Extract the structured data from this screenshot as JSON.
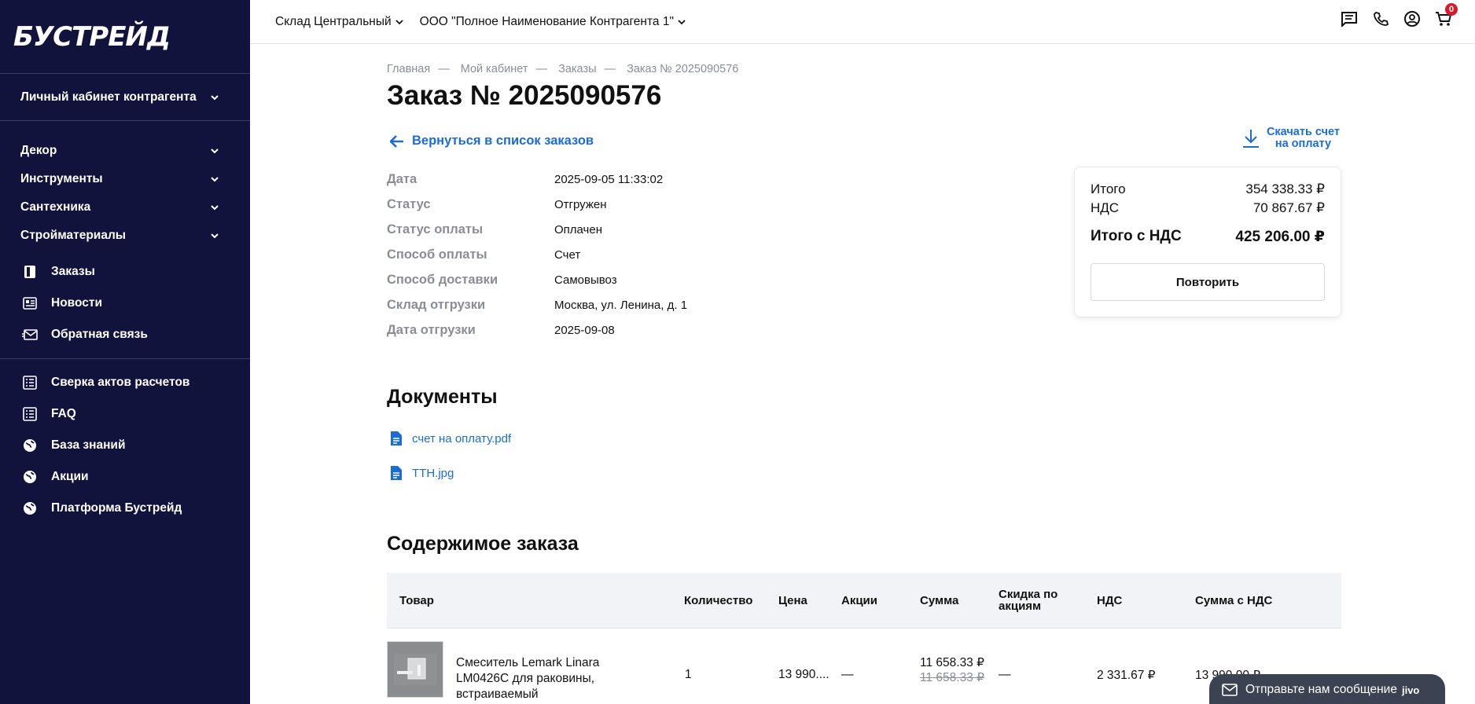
{
  "sidebar": {
    "logo": "БУСТРЕЙД",
    "cabinet": "Личный кабинет контрагента",
    "categories": [
      "Декор",
      "Инструменты",
      "Сантехника",
      "Стройматериалы"
    ],
    "links": [
      {
        "label": "Заказы",
        "icon": "orders-icon"
      },
      {
        "label": "Новости",
        "icon": "news-icon"
      },
      {
        "label": "Обратная связь",
        "icon": "mail-icon"
      }
    ],
    "links2": [
      {
        "label": "Сверка актов расчетов",
        "icon": "list-icon"
      },
      {
        "label": "FAQ",
        "icon": "list-icon"
      },
      {
        "label": "База знаний",
        "icon": "globe-icon"
      },
      {
        "label": "Акции",
        "icon": "globe-icon"
      },
      {
        "label": "Платформа Бустрейд",
        "icon": "globe-icon"
      }
    ]
  },
  "topbar": {
    "warehouse": "Склад Центральный",
    "counterparty": "ООО \"Полное Наименование Контрагента 1\"",
    "cart_count": "0"
  },
  "breadcrumb": [
    "Главная",
    "Мой кабинет",
    "Заказы",
    "Заказ № 2025090576"
  ],
  "title": "Заказ № 2025090576",
  "back_link": "Вернуться в список заказов",
  "download": {
    "line1": "Скачать счет",
    "line2": "на оплату"
  },
  "info": [
    {
      "k": "Дата",
      "v": "2025-09-05 11:33:02"
    },
    {
      "k": "Статус",
      "v": "Отгружен"
    },
    {
      "k": "Статус оплаты",
      "v": "Оплачен"
    },
    {
      "k": "Способ оплаты",
      "v": "Счет"
    },
    {
      "k": "Способ доставки",
      "v": "Самовывоз"
    },
    {
      "k": "Склад отгрузки",
      "v": "Москва, ул. Ленина, д. 1"
    },
    {
      "k": "Дата отгрузки",
      "v": "2025-09-08"
    }
  ],
  "totals": {
    "itogo_label": "Итого",
    "itogo": "354 338.33 ₽",
    "nds_label": "НДС",
    "nds": "70 867.67 ₽",
    "total_label": "Итого с НДС",
    "total": "425 206.00 ₽",
    "repeat": "Повторить"
  },
  "documents_title": "Документы",
  "documents": [
    "счет на оплату.pdf",
    "ТТН.jpg"
  ],
  "contents_title": "Содержимое заказа",
  "table": {
    "headers": {
      "product": "Товар",
      "qty": "Количество",
      "price": "Цена",
      "promo": "Акции",
      "sum": "Сумма",
      "discount_l1": "Скидка по",
      "discount_l2": "акциям",
      "nds": "НДС",
      "sum_nds": "Сумма с НДС"
    },
    "rows": [
      {
        "name": "Смеситель Lemark Linara LM0426C для раковины, встраиваемый",
        "qty": "1",
        "price": "13 990....",
        "promo": "—",
        "sum": "11 658.33 ₽",
        "sum_old": "11 658.33 ₽",
        "discount": "—",
        "nds": "2 331.67 ₽",
        "sum_nds": "13 990.00 ₽"
      }
    ]
  },
  "chat": {
    "text": "Отправьте нам сообщение",
    "brand": "jivo"
  },
  "colors": {
    "sidebar": "#11133d",
    "link": "#1a6dd6",
    "badge": "#d71b2a"
  }
}
